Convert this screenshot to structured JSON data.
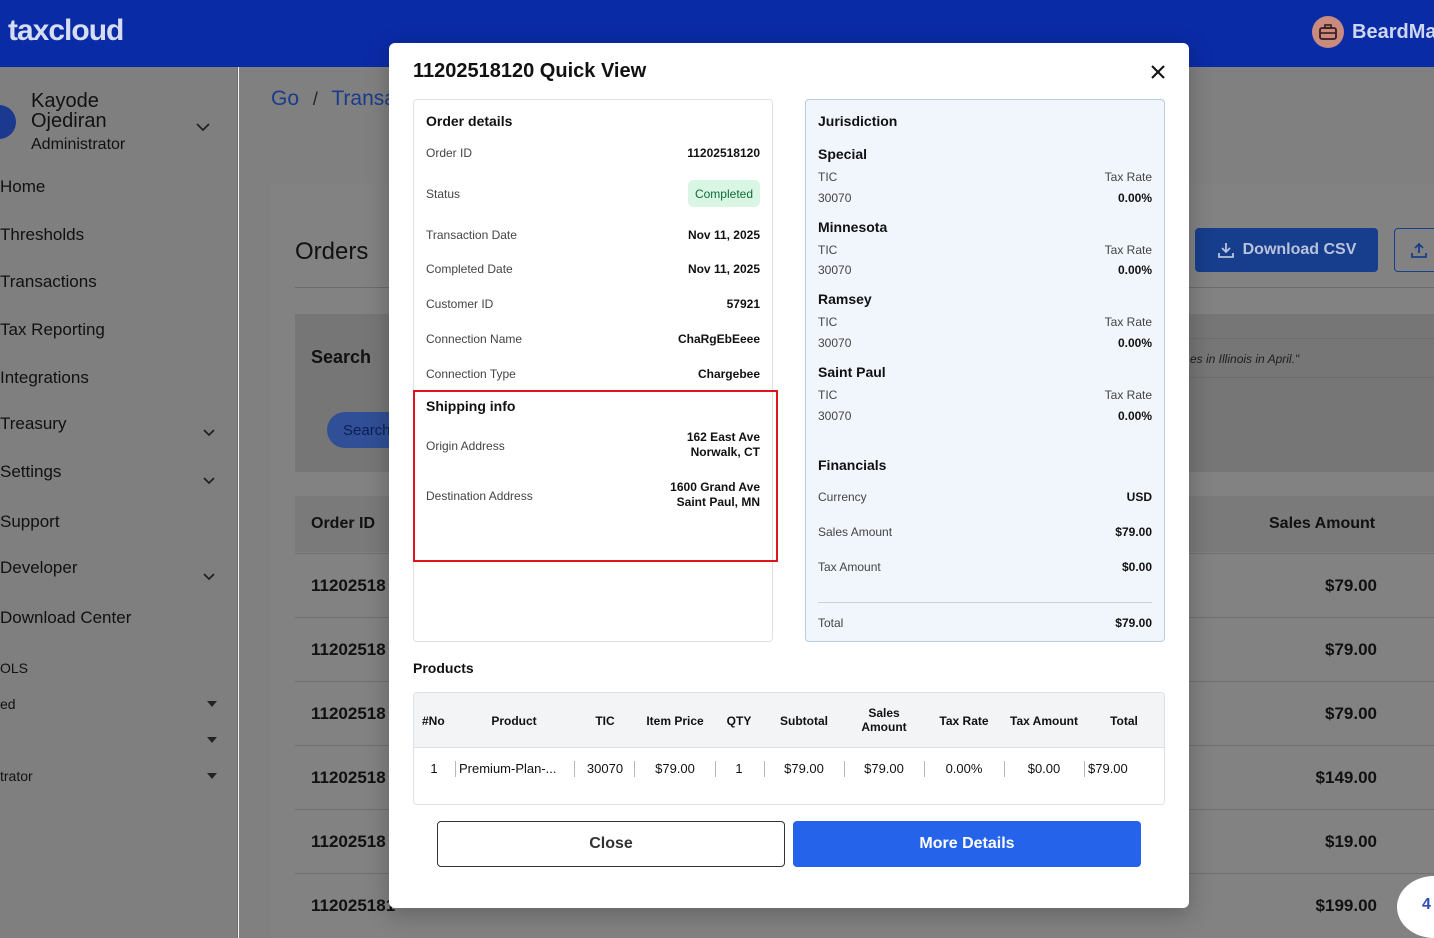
{
  "app": {
    "logo": "taxcloud",
    "brand": "BeardMa"
  },
  "user": {
    "name": "Kayode Ojediran",
    "role": "Administrator"
  },
  "nav": {
    "items": [
      "Home",
      "Thresholds",
      "Transactions",
      "Tax Reporting",
      "Integrations",
      "Treasury",
      "Settings",
      "Support",
      "Developer",
      "Download Center"
    ],
    "tools_label": "OLS",
    "tools": [
      "ed",
      "",
      "trator"
    ]
  },
  "background": {
    "breadcrumb": [
      "Go",
      "Transa"
    ],
    "breadcrumb_sep": "/",
    "orders_title": "Orders",
    "download_csv": "Download CSV",
    "search_label": "Search",
    "search_button": "Search",
    "hint": "es in Illinois in April.\"",
    "col_order_id": "Order ID",
    "col_sales_amount": "Sales Amount",
    "rows": [
      {
        "id": "11202518",
        "amount": "$79.00"
      },
      {
        "id": "11202518",
        "amount": "$79.00"
      },
      {
        "id": "11202518",
        "amount": "$79.00"
      },
      {
        "id": "11202518",
        "amount": "$149.00"
      },
      {
        "id": "11202518",
        "amount": "$19.00"
      },
      {
        "id": "112025181",
        "amount": "$199.00"
      }
    ],
    "fab_count": "4"
  },
  "modal": {
    "title": "11202518120 Quick View",
    "order_details": {
      "title": "Order details",
      "order_id_label": "Order ID",
      "order_id": "11202518120",
      "status_label": "Status",
      "status": "Completed",
      "transaction_date_label": "Transaction Date",
      "transaction_date": "Nov 11, 2025",
      "completed_date_label": "Completed Date",
      "completed_date": "Nov 11, 2025",
      "customer_id_label": "Customer ID",
      "customer_id": "57921",
      "connection_name_label": "Connection Name",
      "connection_name": "ChaRgEbEeee",
      "connection_type_label": "Connection Type",
      "connection_type": "Chargebee"
    },
    "shipping": {
      "title": "Shipping info",
      "origin_label": "Origin Address",
      "origin_line1": "162 East Ave",
      "origin_line2": "Norwalk, CT",
      "destination_label": "Destination Address",
      "destination_line1": "1600 Grand Ave",
      "destination_line2": "Saint Paul, MN"
    },
    "jurisdiction": {
      "title": "Jurisdiction",
      "tic_label": "TIC",
      "tax_rate_label": "Tax Rate",
      "items": [
        {
          "name": "Special",
          "tic": "30070",
          "rate": "0.00%"
        },
        {
          "name": "Minnesota",
          "tic": "30070",
          "rate": "0.00%"
        },
        {
          "name": "Ramsey",
          "tic": "30070",
          "rate": "0.00%"
        },
        {
          "name": "Saint Paul",
          "tic": "30070",
          "rate": "0.00%"
        }
      ]
    },
    "financials": {
      "title": "Financials",
      "currency_label": "Currency",
      "currency": "USD",
      "sales_amount_label": "Sales Amount",
      "sales_amount": "$79.00",
      "tax_amount_label": "Tax Amount",
      "tax_amount": "$0.00",
      "total_label": "Total",
      "total": "$79.00"
    },
    "products": {
      "title": "Products",
      "headers": {
        "no": "#No",
        "product": "Product",
        "tic": "TIC",
        "item_price": "Item Price",
        "qty": "QTY",
        "subtotal": "Subtotal",
        "sales_amount_1": "Sales",
        "sales_amount_2": "Amount",
        "tax_rate": "Tax Rate",
        "tax_amount": "Tax Amount",
        "total": "Total"
      },
      "row": {
        "no": "1",
        "product": "Premium-Plan-...",
        "tic": "30070",
        "item_price": "$79.00",
        "qty": "1",
        "subtotal": "$79.00",
        "sales_amount": "$79.00",
        "tax_rate": "0.00%",
        "tax_amount": "$0.00",
        "total": "$79.00"
      }
    },
    "close_button": "Close",
    "more_details_button": "More Details"
  },
  "colors": {
    "topbar": "#0a2ba6",
    "primary": "#2563eb",
    "highlight": "#e0141c",
    "status_bg": "#d9f5e4"
  }
}
